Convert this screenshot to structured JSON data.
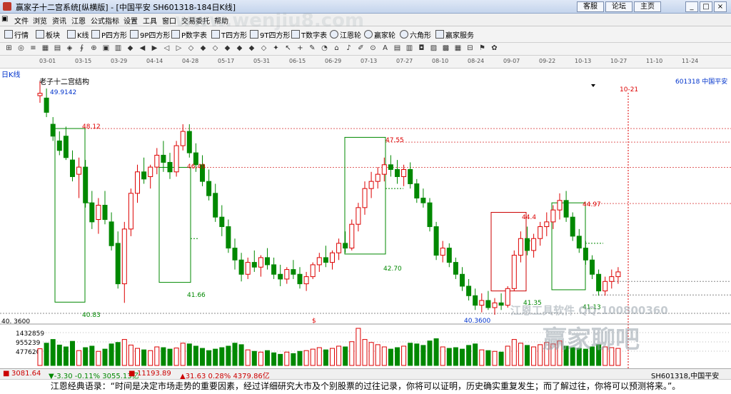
{
  "window": {
    "title": "赢家子十二宫系统[纵横版] - [中国平安  SH601318-184日K线]",
    "top_buttons": [
      "客服",
      "论坛",
      "主页"
    ],
    "controls": [
      "_",
      "□",
      "×"
    ]
  },
  "menu": [
    "文件",
    "浏览",
    "资讯",
    "江恩",
    "公式指标",
    "设置",
    "工具",
    "窗口",
    "交易委托",
    "帮助"
  ],
  "toolbar1": [
    "行情",
    "板块",
    "K线",
    "P四方形",
    "9P四方形",
    "P数字表",
    "T四方形",
    "9T四方形",
    "T数字表",
    "江恩轮",
    "赢家轮",
    "六角形",
    "赢家服务"
  ],
  "chart": {
    "period_label": "日K线",
    "indicator_label": "老子十二宫结构",
    "stock_label": "601318  中国平安",
    "vline_label": "10-21",
    "date_ticks": [
      "03-01",
      "03-15",
      "03-29",
      "04-14",
      "04-28",
      "05-17",
      "05-31",
      "06-15",
      "06-29",
      "07-13",
      "07-27",
      "08-10",
      "08-24",
      "09-07",
      "09-22",
      "10-13",
      "10-27",
      "11-10",
      "11-24"
    ],
    "price_labels": [
      "49.9142",
      "48.12",
      "46.49",
      "47.55",
      "44.97",
      "44.4",
      "42.70",
      "41.66",
      "41.35",
      "41.13",
      "40.83",
      "40.3600"
    ],
    "left_axis_price": "40. 3600",
    "volume_axis": [
      "1432859",
      "955239",
      "477620"
    ],
    "volume_marker": "$"
  },
  "chart_data": {
    "type": "candlestick",
    "candles": [
      [
        49.5,
        50.1,
        49.2,
        49.6
      ],
      [
        49.4,
        49.8,
        48.6,
        48.8
      ],
      [
        48.3,
        48.6,
        47.6,
        47.8
      ],
      [
        47.6,
        48.0,
        47.0,
        47.2
      ],
      [
        47.8,
        48.2,
        46.8,
        46.9
      ],
      [
        46.8,
        47.2,
        45.9,
        46.1
      ],
      [
        46.2,
        46.9,
        45.2,
        46.5
      ],
      [
        46.5,
        46.8,
        44.8,
        45.0
      ],
      [
        45.0,
        45.5,
        43.9,
        44.2
      ],
      [
        44.3,
        45.2,
        43.7,
        44.9
      ],
      [
        44.9,
        45.5,
        44.1,
        44.3
      ],
      [
        44.2,
        44.6,
        43.0,
        43.2
      ],
      [
        43.3,
        43.8,
        41.4,
        41.6
      ],
      [
        41.6,
        44.2,
        40.8,
        43.9
      ],
      [
        43.9,
        45.6,
        43.6,
        45.4
      ],
      [
        45.4,
        46.6,
        45.0,
        46.3
      ],
      [
        46.3,
        46.9,
        45.8,
        46.0
      ],
      [
        46.1,
        46.6,
        45.6,
        46.5
      ],
      [
        46.5,
        47.3,
        46.2,
        47.0
      ],
      [
        47.0,
        47.6,
        46.3,
        46.7
      ],
      [
        46.7,
        47.1,
        46.0,
        46.3
      ],
      [
        46.3,
        47.6,
        46.1,
        47.4
      ],
      [
        47.4,
        48.3,
        47.2,
        48.0
      ],
      [
        48.0,
        48.3,
        46.9,
        47.1
      ],
      [
        47.1,
        47.5,
        46.3,
        46.6
      ],
      [
        46.6,
        47.0,
        45.7,
        45.9
      ],
      [
        45.9,
        46.4,
        45.1,
        45.3
      ],
      [
        45.4,
        45.8,
        44.2,
        44.4
      ],
      [
        44.4,
        44.9,
        43.6,
        44.0
      ],
      [
        44.0,
        44.3,
        42.9,
        43.1
      ],
      [
        43.1,
        43.5,
        42.2,
        42.6
      ],
      [
        42.6,
        42.9,
        41.7,
        42.0
      ],
      [
        42.0,
        42.7,
        41.8,
        42.5
      ],
      [
        42.5,
        43.0,
        42.1,
        42.3
      ],
      [
        42.3,
        42.8,
        41.9,
        42.7
      ],
      [
        42.7,
        43.1,
        42.2,
        42.4
      ],
      [
        42.4,
        42.7,
        41.8,
        42.0
      ],
      [
        42.0,
        42.4,
        41.5,
        41.8
      ],
      [
        41.8,
        42.3,
        41.6,
        42.2
      ],
      [
        42.2,
        42.6,
        41.8,
        42.0
      ],
      [
        42.0,
        42.3,
        41.4,
        41.6
      ],
      [
        41.6,
        42.1,
        41.3,
        41.9
      ],
      [
        41.9,
        42.5,
        41.8,
        42.4
      ],
      [
        42.4,
        42.9,
        42.1,
        42.7
      ],
      [
        42.7,
        43.2,
        42.3,
        42.5
      ],
      [
        42.5,
        43.0,
        42.2,
        42.9
      ],
      [
        42.9,
        43.5,
        42.6,
        43.3
      ],
      [
        43.3,
        43.8,
        42.9,
        43.1
      ],
      [
        43.1,
        44.3,
        43.0,
        44.1
      ],
      [
        44.1,
        45.0,
        43.8,
        44.8
      ],
      [
        44.8,
        45.9,
        44.5,
        45.6
      ],
      [
        45.6,
        46.3,
        45.2,
        45.9
      ],
      [
        45.9,
        46.5,
        45.6,
        46.2
      ],
      [
        46.2,
        46.9,
        45.9,
        46.6
      ],
      [
        46.6,
        47.0,
        46.1,
        46.4
      ],
      [
        46.4,
        46.8,
        45.8,
        46.1
      ],
      [
        46.1,
        46.6,
        45.7,
        46.4
      ],
      [
        46.4,
        46.7,
        45.6,
        45.8
      ],
      [
        45.8,
        46.0,
        45.0,
        45.2
      ],
      [
        45.2,
        45.6,
        44.8,
        45.0
      ],
      [
        45.0,
        45.2,
        43.8,
        44.0
      ],
      [
        44.0,
        44.2,
        42.6,
        42.8
      ],
      [
        42.8,
        43.4,
        42.5,
        43.1
      ],
      [
        43.1,
        43.3,
        42.3,
        42.5
      ],
      [
        42.5,
        42.7,
        41.8,
        42.0
      ],
      [
        42.0,
        42.3,
        41.3,
        41.5
      ],
      [
        41.5,
        41.8,
        40.9,
        41.1
      ],
      [
        41.1,
        41.4,
        40.5,
        40.7
      ],
      [
        40.7,
        41.2,
        40.4,
        40.9
      ],
      [
        40.9,
        41.3,
        40.5,
        40.6
      ],
      [
        40.6,
        41.0,
        40.3,
        40.8
      ],
      [
        40.8,
        41.2,
        40.5,
        40.7
      ],
      [
        40.7,
        41.5,
        40.6,
        41.4
      ],
      [
        41.4,
        43.0,
        41.3,
        42.8
      ],
      [
        42.8,
        43.8,
        42.5,
        43.5
      ],
      [
        43.5,
        44.0,
        42.8,
        43.0
      ],
      [
        43.0,
        43.7,
        42.7,
        43.5
      ],
      [
        43.5,
        44.2,
        43.2,
        44.0
      ],
      [
        44.0,
        44.6,
        43.6,
        44.2
      ],
      [
        44.2,
        44.9,
        43.9,
        44.7
      ],
      [
        44.7,
        45.4,
        44.3,
        45.1
      ],
      [
        45.1,
        45.5,
        44.2,
        44.4
      ],
      [
        44.4,
        44.6,
        43.4,
        43.6
      ],
      [
        43.6,
        43.9,
        42.9,
        43.1
      ],
      [
        43.1,
        43.4,
        42.4,
        42.6
      ],
      [
        42.6,
        42.8,
        41.8,
        42.0
      ],
      [
        42.0,
        42.2,
        41.1,
        41.3
      ],
      [
        41.3,
        41.9,
        41.1,
        41.7
      ],
      [
        41.7,
        42.2,
        41.4,
        41.9
      ],
      [
        41.9,
        42.3,
        41.6,
        42.1
      ]
    ],
    "volumes": [
      45,
      60,
      70,
      55,
      50,
      65,
      40,
      48,
      52,
      38,
      44,
      58,
      62,
      70,
      55,
      46,
      42,
      40,
      50,
      48,
      44,
      47,
      60,
      58,
      52,
      46,
      40,
      44,
      48,
      52,
      60,
      56,
      42,
      38,
      36,
      40,
      34,
      30,
      36,
      32,
      38,
      40,
      44,
      48,
      42,
      46,
      52,
      50,
      64,
      100,
      70,
      62,
      56,
      50,
      44,
      48,
      52,
      60,
      58,
      54,
      66,
      72,
      50,
      46,
      48,
      44,
      54,
      58,
      42,
      40,
      38,
      36,
      52,
      70,
      60,
      54,
      50,
      56,
      62,
      58,
      66,
      52,
      48,
      46,
      44,
      50,
      56,
      50,
      48,
      46
    ]
  },
  "status": {
    "sh_index": "3081.64",
    "sh_change": "▼-3.30  -0.11%  3055.13亿",
    "sz_index": "11193.89",
    "sz_change": "▲31.63  0.28%  4379.86亿",
    "right": "SH601318,中国平安"
  },
  "watermarks": [
    "江恩工具软件  QQ:100800360",
    "赢家聊吧",
    "www.wenjiu8.com"
  ],
  "quote": "江恩经典语录：“时间是决定市场走势的重要因素，经过详细研究大市及个别股票的过往记录，你将可以证明，历史确实重复发生；而了解过往，你将可以预测将来。”。"
}
